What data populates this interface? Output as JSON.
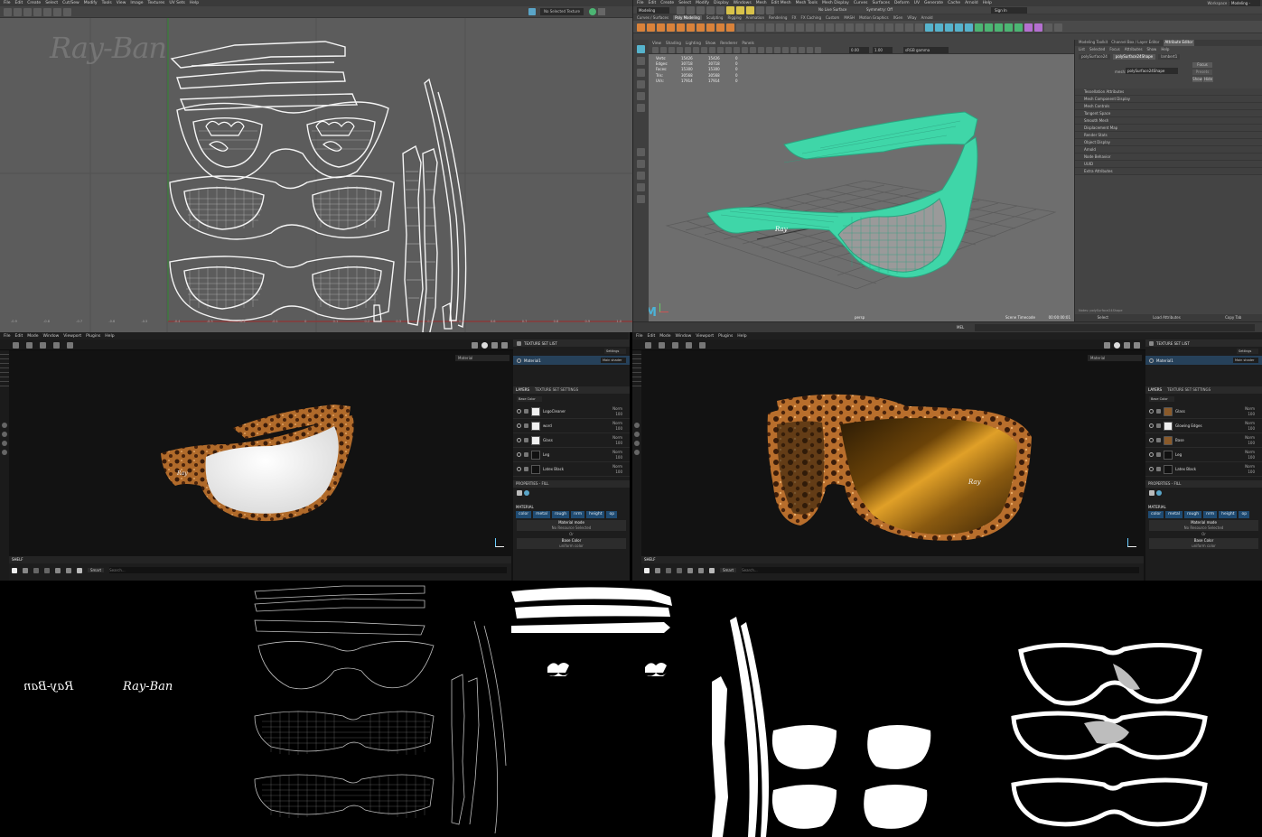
{
  "uv_editor": {
    "menu": [
      "File",
      "Edit",
      "Create",
      "Select",
      "Cut/Sew",
      "Modify",
      "Tools",
      "View",
      "Image",
      "Textures",
      "UV Sets",
      "Help"
    ],
    "texture_dropdown": "No Selected Texture",
    "watermark": "Ray-Ban",
    "axis_ticks": [
      "-0.9",
      "-0.8",
      "-0.7",
      "-0.6",
      "-0.5",
      "-0.4",
      "-0.3",
      "-0.2",
      "-0.1",
      "0",
      "0.1",
      "0.2",
      "0.3",
      "0.4",
      "0.5",
      "0.6",
      "0.7",
      "0.8",
      "0.9",
      "1.0"
    ]
  },
  "maya": {
    "menu": [
      "File",
      "Edit",
      "Create",
      "Select",
      "Modify",
      "Display",
      "Windows",
      "Mesh",
      "Edit Mesh",
      "Mesh Tools",
      "Mesh Display",
      "Curves",
      "Surfaces",
      "Deform",
      "UV",
      "Generate",
      "Cache",
      "Arnold",
      "Help"
    ],
    "workspace_label": "Workspace :",
    "workspace_value": "Modeling - Standard*",
    "mode": "Modeling",
    "live_surface": "No Live Surface",
    "symmetry": "Symmetry: Off",
    "sign_in": "Sign In",
    "shelf_tabs": [
      "Curves / Surfaces",
      "Poly Modeling",
      "Sculpting",
      "Rigging",
      "Animation",
      "Rendering",
      "FX",
      "FX Caching",
      "Custom",
      "MASH",
      "Motion Graphics",
      "XGen",
      "VRay",
      "Arnold"
    ],
    "panel_menu": [
      "View",
      "Shading",
      "Lighting",
      "Show",
      "Renderer",
      "Panels"
    ],
    "field_values": [
      "0.00",
      "1.00"
    ],
    "color_space": "sRGB gamma",
    "hud": [
      {
        "label": "Verts:",
        "a": "15426",
        "b": "15426",
        "c": "0"
      },
      {
        "label": "Edges:",
        "a": "30718",
        "b": "30718",
        "c": "0"
      },
      {
        "label": "Faces:",
        "a": "15300",
        "b": "15300",
        "c": "0"
      },
      {
        "label": "Tris:",
        "a": "30568",
        "b": "30568",
        "c": "0"
      },
      {
        "label": "UVs:",
        "a": "17914",
        "b": "17914",
        "c": "0"
      }
    ],
    "camera": "persp",
    "scene_timecode_label": "Scene Timecode",
    "scene_timecode": "00:00:00:01",
    "mel": "MEL",
    "logo": "M",
    "attr": {
      "top_tabs": [
        "Modeling Toolkit",
        "Channel Box / Layer Editor",
        "Attribute Editor"
      ],
      "menu": [
        "List",
        "Selected",
        "Focus",
        "Attributes",
        "Show",
        "Help"
      ],
      "node_tabs": [
        "polySurface24",
        "polySurface24Shape",
        "lambert1"
      ],
      "mesh_label": "mesh:",
      "mesh_value": "polySurface24Shape",
      "focus": "Focus",
      "presets": "Presets",
      "show": "Show",
      "hide": "Hide",
      "sections": [
        "Tessellation Attributes",
        "Mesh Component Display",
        "Mesh Controls",
        "Tangent Space",
        "Smooth Mesh",
        "Displacement Map",
        "Render Stats",
        "Object Display",
        "Arnold",
        "Node Behavior",
        "UUID",
        "Extra Attributes"
      ],
      "notes": "Notes: polySurface24Shape",
      "buttons": [
        "Select",
        "Load Attributes",
        "Copy Tab"
      ]
    }
  },
  "painter_left": {
    "menu": [
      "File",
      "Edit",
      "Mode",
      "Window",
      "Viewport",
      "Plugins",
      "Help"
    ],
    "viewport_mode": "Material",
    "texture_set_list": "TEXTURE SET LIST",
    "settings": "Settings",
    "material": "Material1",
    "shader": "Main shader",
    "layers_tab": "LAYERS",
    "tss_tab": "TEXTURE SET SETTINGS",
    "channel": "Base Color",
    "layers": [
      {
        "name": "LogoCleaner",
        "blend": "Norm",
        "opacity": "100",
        "thumb": "white"
      },
      {
        "name": "word",
        "blend": "Norm",
        "opacity": "100",
        "thumb": "white"
      },
      {
        "name": "Glass",
        "blend": "Norm",
        "opacity": "100",
        "thumb": "white"
      },
      {
        "name": "Leg",
        "blend": "Norm",
        "opacity": "100",
        "thumb": "dark"
      },
      {
        "name": "Latex Black",
        "blend": "Norm",
        "opacity": "100",
        "thumb": "dark"
      }
    ],
    "properties": "PROPERTIES - FILL",
    "material_heading": "MATERIAL",
    "channels": [
      "color",
      "metal",
      "rough",
      "nrm",
      "height",
      "op"
    ],
    "material_mode": "Material mode",
    "no_resource": "No Resource Selected",
    "or": "Or",
    "base_color": "Base Color",
    "uniform": "uniform color",
    "shelf": "SHELF",
    "shelf_filter": "Smart",
    "search_placeholder": "Search..."
  },
  "painter_right": {
    "menu": [
      "File",
      "Edit",
      "Mode",
      "Window",
      "Viewport",
      "Plugins",
      "Help"
    ],
    "viewport_mode": "Material",
    "texture_set_list": "TEXTURE SET LIST",
    "settings": "Settings",
    "material": "Material1",
    "shader": "Main shader",
    "layers_tab": "LAYERS",
    "tss_tab": "TEXTURE SET SETTINGS",
    "channel": "Base Color",
    "layers": [
      {
        "name": "Glass",
        "blend": "Norm",
        "opacity": "100",
        "thumb": "brown"
      },
      {
        "name": "Glowing Edges",
        "blend": "Norm",
        "opacity": "100",
        "thumb": "white"
      },
      {
        "name": "Base",
        "blend": "Norm",
        "opacity": "100",
        "thumb": "brown"
      },
      {
        "name": "Leg",
        "blend": "Norm",
        "opacity": "100",
        "thumb": "dark"
      },
      {
        "name": "Latex Black",
        "blend": "Norm",
        "opacity": "100",
        "thumb": "dark"
      }
    ],
    "properties": "PROPERTIES - FILL",
    "material_heading": "MATERIAL",
    "channels": [
      "color",
      "metal",
      "rough",
      "nrm",
      "height",
      "op"
    ],
    "material_mode": "Material mode",
    "no_resource": "No Resource Selected",
    "or": "Or",
    "base_color": "Base Color",
    "uniform": "uniform color",
    "shelf": "SHELF",
    "shelf_filter": "Smart",
    "search_placeholder": "Search..."
  },
  "texture_maps": {
    "logo_mirrored": "Ray-Ban",
    "logo": "Ray-Ban"
  },
  "colors": {
    "uv_bg": "#5c5c5c",
    "maya_viewport": "#6e6e6e",
    "wire_green": "#3fd6a8",
    "tortoise": "#b06a2a",
    "accent_blue": "#1f6fb2",
    "painter_bg": "#121212"
  }
}
